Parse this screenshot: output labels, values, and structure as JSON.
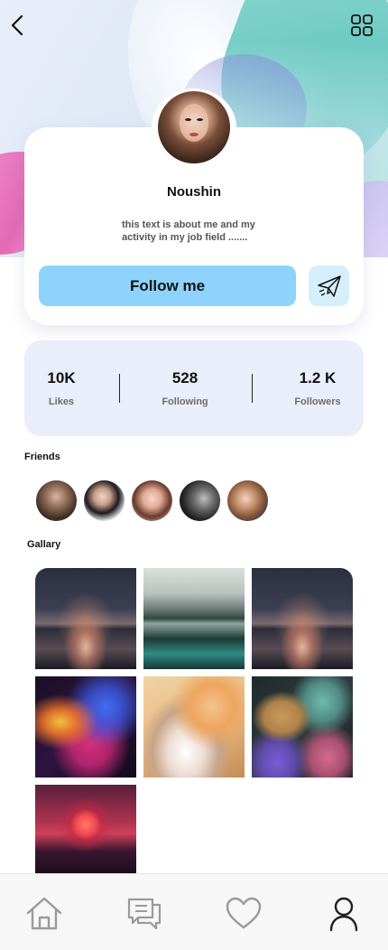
{
  "profile": {
    "name": "Noushin",
    "bio": "this text is about me and my activity in my job field .......",
    "follow_label": "Follow me"
  },
  "stats": [
    {
      "value": "10K",
      "label": "Likes"
    },
    {
      "value": "528",
      "label": "Following"
    },
    {
      "value": "1.2 K",
      "label": "Followers"
    }
  ],
  "sections": {
    "friends_title": "Friends",
    "gallery_title": "Gallary"
  },
  "icons": {
    "back": "back-arrow-icon",
    "menu": "grid-menu-icon",
    "send": "send-icon",
    "home": "home-icon",
    "messages": "chat-icon",
    "favorites": "heart-icon",
    "profile": "user-icon"
  },
  "colors": {
    "follow_button": "#8dd3fb",
    "send_button": "#d5effc",
    "stats_background": "#eaeefa",
    "active_nav": "#222222",
    "inactive_nav": "#9a9a9a"
  }
}
